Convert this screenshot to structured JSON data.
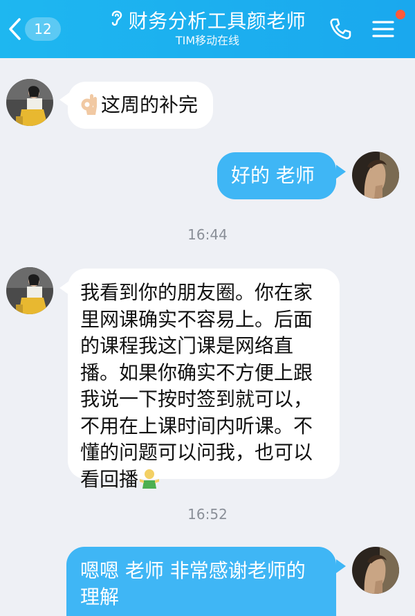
{
  "header": {
    "unread_count": "12",
    "title": "财务分析工具颜老师",
    "subtitle": "TIM移动在线",
    "bg_color": "#1aa8ee",
    "icons": {
      "back": "chevron-left-icon",
      "ear": "ear-icon",
      "phone": "phone-icon",
      "menu": "menu-icon"
    }
  },
  "messages": [
    {
      "side": "left",
      "text": "这周的补完",
      "emoji_prefix": "ok-hand-emoji"
    },
    {
      "side": "right",
      "text": "好的 老师"
    },
    {
      "type": "time",
      "text": "16:44"
    },
    {
      "side": "left",
      "lines": [
        "我看到你的朋友圈。你在家",
        "里网课确实不容易上。后面",
        "的课程我这门课是网络直",
        "播。如果你确实不方便上跟",
        "我说一下按时签到就可以，",
        "不用在上课时间内听课。不",
        "懂的问题可以问我，也可以",
        "看回播"
      ],
      "emoji_suffix": "shrug-person-emoji"
    },
    {
      "type": "time",
      "text": "16:52"
    },
    {
      "side": "right",
      "lines": [
        "嗯嗯 老师 非常感谢老师的",
        "理解"
      ]
    }
  ],
  "colors": {
    "my_bubble": "#3fb6f5",
    "their_bubble": "#ffffff",
    "background": "#eef0f5",
    "time": "#8a8f98"
  }
}
